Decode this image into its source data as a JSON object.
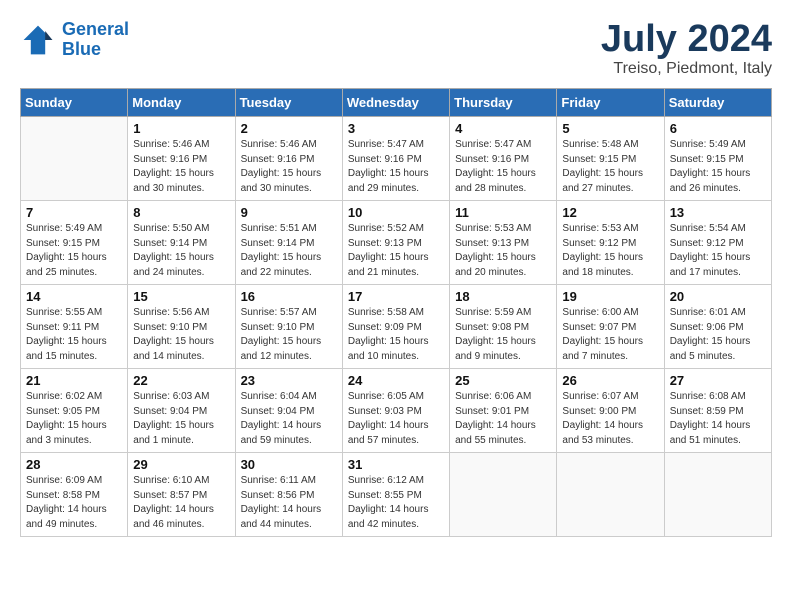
{
  "logo": {
    "line1": "General",
    "line2": "Blue"
  },
  "title": "July 2024",
  "location": "Treiso, Piedmont, Italy",
  "weekdays": [
    "Sunday",
    "Monday",
    "Tuesday",
    "Wednesday",
    "Thursday",
    "Friday",
    "Saturday"
  ],
  "weeks": [
    [
      {
        "day": "",
        "sunrise": "",
        "sunset": "",
        "daylight": ""
      },
      {
        "day": "1",
        "sunrise": "5:46 AM",
        "sunset": "9:16 PM",
        "daylight": "15 hours and 30 minutes."
      },
      {
        "day": "2",
        "sunrise": "5:46 AM",
        "sunset": "9:16 PM",
        "daylight": "15 hours and 30 minutes."
      },
      {
        "day": "3",
        "sunrise": "5:47 AM",
        "sunset": "9:16 PM",
        "daylight": "15 hours and 29 minutes."
      },
      {
        "day": "4",
        "sunrise": "5:47 AM",
        "sunset": "9:16 PM",
        "daylight": "15 hours and 28 minutes."
      },
      {
        "day": "5",
        "sunrise": "5:48 AM",
        "sunset": "9:15 PM",
        "daylight": "15 hours and 27 minutes."
      },
      {
        "day": "6",
        "sunrise": "5:49 AM",
        "sunset": "9:15 PM",
        "daylight": "15 hours and 26 minutes."
      }
    ],
    [
      {
        "day": "7",
        "sunrise": "5:49 AM",
        "sunset": "9:15 PM",
        "daylight": "15 hours and 25 minutes."
      },
      {
        "day": "8",
        "sunrise": "5:50 AM",
        "sunset": "9:14 PM",
        "daylight": "15 hours and 24 minutes."
      },
      {
        "day": "9",
        "sunrise": "5:51 AM",
        "sunset": "9:14 PM",
        "daylight": "15 hours and 22 minutes."
      },
      {
        "day": "10",
        "sunrise": "5:52 AM",
        "sunset": "9:13 PM",
        "daylight": "15 hours and 21 minutes."
      },
      {
        "day": "11",
        "sunrise": "5:53 AM",
        "sunset": "9:13 PM",
        "daylight": "15 hours and 20 minutes."
      },
      {
        "day": "12",
        "sunrise": "5:53 AM",
        "sunset": "9:12 PM",
        "daylight": "15 hours and 18 minutes."
      },
      {
        "day": "13",
        "sunrise": "5:54 AM",
        "sunset": "9:12 PM",
        "daylight": "15 hours and 17 minutes."
      }
    ],
    [
      {
        "day": "14",
        "sunrise": "5:55 AM",
        "sunset": "9:11 PM",
        "daylight": "15 hours and 15 minutes."
      },
      {
        "day": "15",
        "sunrise": "5:56 AM",
        "sunset": "9:10 PM",
        "daylight": "15 hours and 14 minutes."
      },
      {
        "day": "16",
        "sunrise": "5:57 AM",
        "sunset": "9:10 PM",
        "daylight": "15 hours and 12 minutes."
      },
      {
        "day": "17",
        "sunrise": "5:58 AM",
        "sunset": "9:09 PM",
        "daylight": "15 hours and 10 minutes."
      },
      {
        "day": "18",
        "sunrise": "5:59 AM",
        "sunset": "9:08 PM",
        "daylight": "15 hours and 9 minutes."
      },
      {
        "day": "19",
        "sunrise": "6:00 AM",
        "sunset": "9:07 PM",
        "daylight": "15 hours and 7 minutes."
      },
      {
        "day": "20",
        "sunrise": "6:01 AM",
        "sunset": "9:06 PM",
        "daylight": "15 hours and 5 minutes."
      }
    ],
    [
      {
        "day": "21",
        "sunrise": "6:02 AM",
        "sunset": "9:05 PM",
        "daylight": "15 hours and 3 minutes."
      },
      {
        "day": "22",
        "sunrise": "6:03 AM",
        "sunset": "9:04 PM",
        "daylight": "15 hours and 1 minute."
      },
      {
        "day": "23",
        "sunrise": "6:04 AM",
        "sunset": "9:04 PM",
        "daylight": "14 hours and 59 minutes."
      },
      {
        "day": "24",
        "sunrise": "6:05 AM",
        "sunset": "9:03 PM",
        "daylight": "14 hours and 57 minutes."
      },
      {
        "day": "25",
        "sunrise": "6:06 AM",
        "sunset": "9:01 PM",
        "daylight": "14 hours and 55 minutes."
      },
      {
        "day": "26",
        "sunrise": "6:07 AM",
        "sunset": "9:00 PM",
        "daylight": "14 hours and 53 minutes."
      },
      {
        "day": "27",
        "sunrise": "6:08 AM",
        "sunset": "8:59 PM",
        "daylight": "14 hours and 51 minutes."
      }
    ],
    [
      {
        "day": "28",
        "sunrise": "6:09 AM",
        "sunset": "8:58 PM",
        "daylight": "14 hours and 49 minutes."
      },
      {
        "day": "29",
        "sunrise": "6:10 AM",
        "sunset": "8:57 PM",
        "daylight": "14 hours and 46 minutes."
      },
      {
        "day": "30",
        "sunrise": "6:11 AM",
        "sunset": "8:56 PM",
        "daylight": "14 hours and 44 minutes."
      },
      {
        "day": "31",
        "sunrise": "6:12 AM",
        "sunset": "8:55 PM",
        "daylight": "14 hours and 42 minutes."
      },
      {
        "day": "",
        "sunrise": "",
        "sunset": "",
        "daylight": ""
      },
      {
        "day": "",
        "sunrise": "",
        "sunset": "",
        "daylight": ""
      },
      {
        "day": "",
        "sunrise": "",
        "sunset": "",
        "daylight": ""
      }
    ]
  ]
}
